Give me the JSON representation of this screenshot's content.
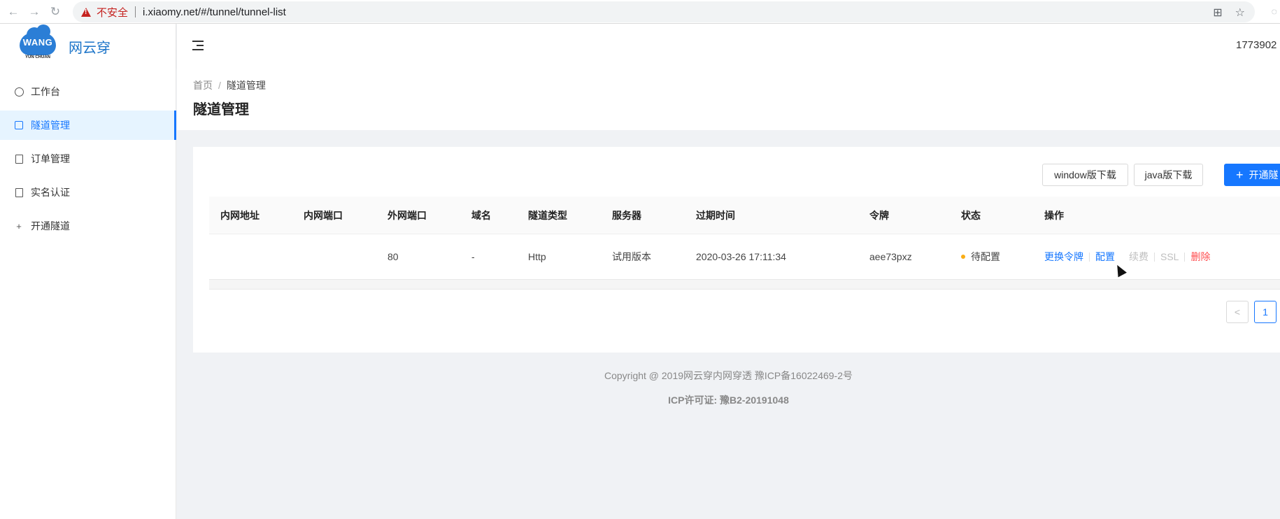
{
  "browser": {
    "security_label": "不安全",
    "url": "i.xiaomy.net/#/tunnel/tunnel-list"
  },
  "sidebar": {
    "brand": "网云穿",
    "logo_text": "WANG",
    "logo_sub": "YUN CHUAN",
    "items": [
      {
        "label": "工作台",
        "icon": "dashboard-icon",
        "active": false
      },
      {
        "label": "隧道管理",
        "icon": "tunnel-icon",
        "active": true
      },
      {
        "label": "订单管理",
        "icon": "order-icon",
        "active": false
      },
      {
        "label": "实名认证",
        "icon": "id-card-icon",
        "active": false
      },
      {
        "label": "开通隧道",
        "icon": "plus-icon",
        "active": false
      }
    ]
  },
  "header": {
    "user_id": "1773902"
  },
  "page": {
    "breadcrumb": [
      "首页",
      "隧道管理"
    ],
    "title": "隧道管理"
  },
  "toolbar": {
    "window_download": "window版下载",
    "java_download": "java版下载",
    "open_tunnel": "开通隧"
  },
  "table": {
    "columns": [
      "内网地址",
      "内网端口",
      "外网端口",
      "域名",
      "隧道类型",
      "服务器",
      "过期时间",
      "令牌",
      "状态",
      "操作"
    ],
    "rows": [
      {
        "lan_addr": "",
        "lan_port": "",
        "wan_port": "80",
        "domain": "-",
        "type": "Http",
        "server": "试用版本",
        "expire": "2020-03-26 17:11:34",
        "token": "aee73pxz",
        "status": "待配置",
        "actions": {
          "change_token": "更换令牌",
          "configure": "配置",
          "renew": "续费",
          "ssl": "SSL",
          "delete": "删除"
        }
      }
    ]
  },
  "pagination": {
    "prev": "<",
    "current": "1"
  },
  "footer": {
    "copyright": "Copyright @ 2019网云穿内网穿透 豫ICP备16022469-2号",
    "license": "ICP许可证: 豫B2-20191048"
  },
  "colors": {
    "primary": "#1677ff",
    "danger": "#ff4d4f",
    "warning": "#faad14",
    "brand": "#1a73c8"
  }
}
